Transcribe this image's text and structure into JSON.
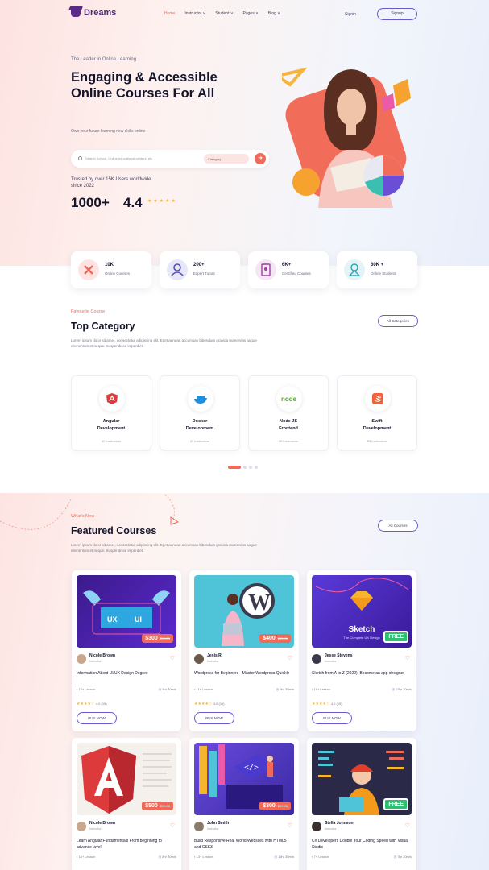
{
  "nav": {
    "logo": "Dreams",
    "links": [
      "Home",
      "Instructor ∨",
      "Student ∨",
      "Pages ∨",
      "Blog ∨"
    ],
    "signin": "Signin",
    "signup": "Signup"
  },
  "hero": {
    "tagline": "The Leader in Online Learning",
    "headline": "Engaging & Accessible Online Courses For All",
    "subtext": "Own your future learning new skills online",
    "search_placeholder": "Search School, Online educational centers, etc",
    "search_category": "Category",
    "trusted": "Trusted by over 15K Users worldwide since 2022",
    "stat_1": "1000+",
    "stat_2": "4.4",
    "rating_stars": 5
  },
  "stats": [
    {
      "value": "10K",
      "label": "Online Courses",
      "icon": "pencil-ruler-icon",
      "color": "#fde4e2"
    },
    {
      "value": "200+",
      "label": "Expert Tutors",
      "icon": "tutor-icon",
      "color": "#e6e8f8"
    },
    {
      "value": "6K+",
      "label": "Ceritified Courses",
      "icon": "certificate-icon",
      "color": "#f4e6f4"
    },
    {
      "value": "60K +",
      "label": "Online Students",
      "icon": "student-icon",
      "color": "#e4f4f6"
    }
  ],
  "categories_section": {
    "label": "Favourite Course",
    "title": "Top Category",
    "desc": "Lorem ipsum dolor sit amet, consectetur adipiscing elit. Eget aenean accumsan bibendum gravida maecenas augue elementum et neque. Suspendisse imperdiet.",
    "button": "All Categories",
    "items": [
      {
        "name": "Angular\nDevelopment",
        "count": "40 Instructors",
        "icon": "angular-icon"
      },
      {
        "name": "Docker\nDevelopment",
        "count": "45 Instructors",
        "icon": "docker-icon"
      },
      {
        "name": "Node JS\nFrontend",
        "count": "40 Instructors",
        "icon": "nodejs-icon"
      },
      {
        "name": "Swift\nDevelopment",
        "count": "23 Instructors",
        "icon": "swift-icon"
      }
    ]
  },
  "featured_section": {
    "label": "What's New",
    "title": "Featured Courses",
    "desc": "Lorem ipsum dolor sit amet, consectetur adipiscing elit. Eget aenean accumsan bibendum gravida maecenas augue elementum et neque. Suspendisse imperdiet.",
    "button": "All Courses"
  },
  "courses": [
    {
      "author": "Nicole Brown",
      "role": "Instructor",
      "title": "Information About UI/UX Design Degree",
      "lessons": "12+ Lesson",
      "duration": "9hr 30min",
      "price": "$300",
      "old_price": "$99.00",
      "rating": "★★★★☆",
      "rating_text": "4.0 (15)",
      "buy": "BUY NOW",
      "thumb": "uxui-thumbnail"
    },
    {
      "author": "Jenis R.",
      "role": "Instructor",
      "title": "Wordpress for Beginners - Master Wordpress Quickly",
      "lessons": "11+ Lesson",
      "duration": "6hr 30min",
      "price": "$400",
      "old_price": "$99.00",
      "rating": "★★★★☆",
      "rating_text": "4.0 (15)",
      "buy": "BUY NOW",
      "thumb": "wordpress-thumbnail"
    },
    {
      "author": "Jesse Stevens",
      "role": "Instructor",
      "title": "Sketch from A to Z (2022): Become an app designer",
      "lessons": "16+ Lesson",
      "duration": "12hr 30min",
      "price": "FREE",
      "old_price": "",
      "rating": "★★★★☆",
      "rating_text": "4.0 (15)",
      "buy": "BUY NOW",
      "thumb": "sketch-thumbnail",
      "thumb_title": "Sketch",
      "thumb_sub": "The Complete UX Design"
    },
    {
      "author": "Nicole Brown",
      "role": "Instructor",
      "title": "Learn Angular Fundamentals From beginning to advance lavel",
      "lessons": "10+ Lesson",
      "duration": "8hr 30min",
      "price": "$500",
      "old_price": "$99.00",
      "rating": "",
      "rating_text": "",
      "buy": "",
      "thumb": "angular-thumbnail"
    },
    {
      "author": "John Smith",
      "role": "Instructor",
      "title": "Build Responsive Real World Websites with HTML5 and CSS3",
      "lessons": "13+ Lesson",
      "duration": "10hr 30min",
      "price": "$300",
      "old_price": "$99.00",
      "rating": "",
      "rating_text": "",
      "buy": "",
      "thumb": "html-thumbnail"
    },
    {
      "author": "Stella Johnson",
      "role": "Instructor",
      "title": "C# Developers Double Your Coding Speed with Visual Studio",
      "lessons": "7+ Lesson",
      "duration": "7hr 30min",
      "price": "FREE",
      "old_price": "",
      "rating": "",
      "rating_text": "",
      "buy": "",
      "thumb": "csharp-thumbnail"
    }
  ]
}
